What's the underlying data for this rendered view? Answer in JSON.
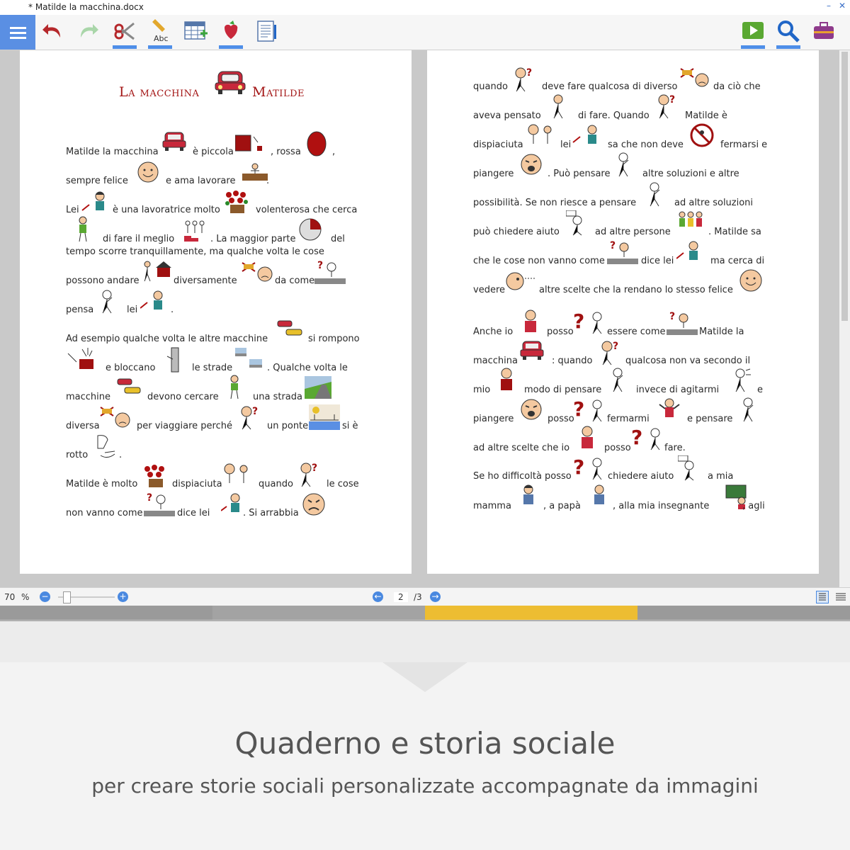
{
  "window": {
    "title": "*  Matilde la macchina.docx",
    "controls": {
      "minimize": "–",
      "restore": "❐",
      "close": "✕"
    }
  },
  "toolbar": {
    "menu_icon": "hamburger-menu-icon",
    "tools": [
      "undo-icon",
      "redo-icon",
      "cut-icon",
      "spellcheck-icon",
      "table-icon",
      "symbol-icon",
      "document-icon"
    ],
    "right_tools": [
      "play-icon",
      "search-icon",
      "toolbox-icon"
    ],
    "colors": {
      "menu_bg": "#5a8fe3",
      "accent": "#4e8ee8",
      "undo": "#b5282b",
      "play": "#5aa832",
      "search": "#2066c7",
      "toolbox": "#8e3a8b"
    }
  },
  "page1": {
    "title_left": "La macchina",
    "title_right": "Matilde",
    "lines": [
      [
        "Matilde la macchina",
        "è piccola",
        ", rossa",
        ","
      ],
      [
        "sempre  felice",
        "e ama lavorare",
        "."
      ],
      [
        "Lei",
        "è una lavoratrice molto",
        "volenterosa che cerca"
      ],
      [
        "di fare il meglio",
        ". La maggior parte",
        "del"
      ],
      [
        "tempo scorre  tranquillamente, ma qualche volta le cose"
      ],
      [
        "possono andare",
        "diversamente",
        "da come"
      ],
      [
        "pensa",
        "lei",
        "."
      ],
      [
        "Ad esempio qualche volta le altre macchine",
        "si rompono"
      ],
      [
        "e bloccano",
        "le strade",
        ". Qualche volta le"
      ],
      [
        "macchine",
        "devono cercare",
        "una strada"
      ],
      [
        "diversa",
        "per viaggiare perché",
        "un ponte",
        "si è"
      ],
      [
        "rotto",
        "."
      ],
      [
        "Matilde è molto",
        "dispiaciuta",
        "quando",
        "le cose"
      ],
      [
        "non vanno come",
        "dice lei",
        ". Si arrabbia"
      ]
    ]
  },
  "page2": {
    "lines": [
      [
        "quando",
        "deve fare qualcosa di diverso",
        "da ciò che"
      ],
      [
        "aveva pensato",
        "di fare. Quando",
        "Matilde è"
      ],
      [
        "dispiaciuta",
        "lei",
        "sa che non deve",
        "fermarsi e"
      ],
      [
        "piangere",
        ". Può pensare",
        "altre soluzioni e altre"
      ],
      [
        "possibilità. Se non riesce a pensare",
        "ad altre soluzioni"
      ],
      [
        "può chiedere aiuto",
        "ad altre persone",
        ". Matilde sa"
      ],
      [
        "che le cose non vanno come",
        "dice lei",
        "ma cerca di"
      ],
      [
        "vedere",
        "altre scelte che la rendano lo stesso felice"
      ],
      [
        "Anche io",
        "posso",
        "essere come",
        "Matilde la"
      ],
      [
        "macchina",
        ": quando",
        "qualcosa non va secondo il"
      ],
      [
        "mio",
        "modo di pensare",
        "invece di agitarmi",
        "e"
      ],
      [
        "piangere",
        "posso",
        "fermarmi",
        "e pensare"
      ],
      [
        "ad altre scelte che io",
        "posso",
        "fare."
      ],
      [
        "Se ho difficoltà posso",
        "chiedere aiuto",
        "a mia"
      ],
      [
        "mamma",
        ", a papà",
        ", alla mia insegnante",
        ", agli"
      ]
    ]
  },
  "status": {
    "zoom": "70",
    "zoom_unit": "%",
    "zoom_level": 0.1,
    "page_current": "2",
    "page_total": "/3"
  },
  "caption": {
    "title": "Quaderno e storia sociale",
    "subtitle": "per creare storie sociali personalizzate accompagnate da immagini"
  }
}
